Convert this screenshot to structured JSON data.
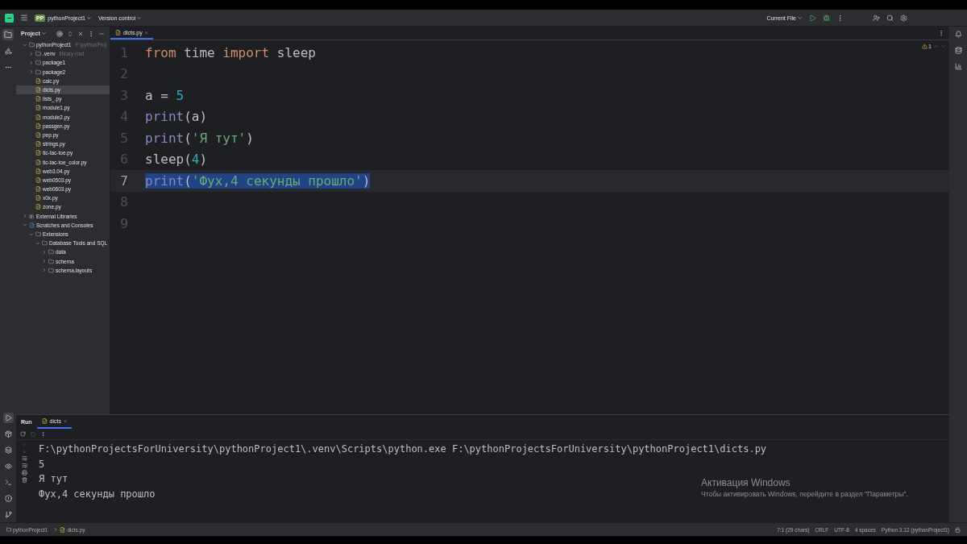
{
  "title_bar": {
    "project_badge": "PP",
    "project": "pythonProject1",
    "vcs": "Version control",
    "run_config": "Current File"
  },
  "project_panel": {
    "title": "Project",
    "tree": [
      {
        "label": "pythonProject1",
        "hint": "F:\\pythonProj",
        "kind": "folder",
        "expanded": true,
        "selected": false,
        "children": [
          {
            "label": ".venv",
            "hint": "library root",
            "kind": "folder",
            "expanded": false,
            "selected": false
          },
          {
            "label": "package1",
            "kind": "folder",
            "expanded": false,
            "selected": false
          },
          {
            "label": "package2",
            "kind": "folder",
            "expanded": false,
            "selected": false
          },
          {
            "label": "calc.py",
            "kind": "python",
            "selected": false
          },
          {
            "label": "dicts.py",
            "kind": "python",
            "selected": true
          },
          {
            "label": "lists_.py",
            "kind": "python",
            "selected": false
          },
          {
            "label": "module1.py",
            "kind": "python",
            "selected": false
          },
          {
            "label": "module2.py",
            "kind": "python",
            "selected": false
          },
          {
            "label": "passgen.py",
            "kind": "python",
            "selected": false
          },
          {
            "label": "pep.py",
            "kind": "python",
            "selected": false
          },
          {
            "label": "strings.py",
            "kind": "python",
            "selected": false
          },
          {
            "label": "tic-tac-toe.py",
            "kind": "python",
            "selected": false
          },
          {
            "label": "tic-tac-toe_color.py",
            "kind": "python",
            "selected": false
          },
          {
            "label": "web3.04.py",
            "kind": "python",
            "selected": false
          },
          {
            "label": "web0503.py",
            "kind": "python",
            "selected": false
          },
          {
            "label": "web0603.py",
            "kind": "python",
            "selected": false
          },
          {
            "label": "x0x.py",
            "kind": "python",
            "selected": false
          },
          {
            "label": "zone.py",
            "kind": "python",
            "selected": false
          }
        ]
      },
      {
        "label": "External Libraries",
        "kind": "library",
        "expanded": false,
        "selected": false
      },
      {
        "label": "Scratches and Consoles",
        "kind": "scratches",
        "expanded": true,
        "selected": false,
        "children": [
          {
            "label": "Extensions",
            "kind": "folder",
            "expanded": true,
            "selected": false,
            "children": [
              {
                "label": "Database Tools and SQL",
                "kind": "folder",
                "expanded": true,
                "selected": false,
                "children": [
                  {
                    "label": "data",
                    "kind": "folder",
                    "expanded": false,
                    "selected": false
                  },
                  {
                    "label": "schema",
                    "kind": "folder",
                    "expanded": false,
                    "selected": false
                  },
                  {
                    "label": "schema.layouts",
                    "kind": "folder",
                    "expanded": false,
                    "selected": false
                  }
                ]
              }
            ]
          }
        ]
      }
    ]
  },
  "editor": {
    "tabs": [
      {
        "label": "dicts.py",
        "close": "×",
        "selected": true
      }
    ],
    "warnings": "1",
    "lines": [
      {
        "number": "1",
        "selected": false,
        "tokens": [
          {
            "text": "from",
            "kind": "keyword"
          },
          {
            "text": " time ",
            "kind": "plain"
          },
          {
            "text": "import",
            "kind": "keyword"
          },
          {
            "text": " sleep",
            "kind": "plain"
          }
        ]
      },
      {
        "number": "2",
        "selected": false
      },
      {
        "number": "3",
        "selected": false,
        "tokens": [
          {
            "text": "a = ",
            "kind": "plain"
          },
          {
            "text": "5",
            "kind": "number"
          }
        ]
      },
      {
        "number": "4",
        "selected": false,
        "tokens": [
          {
            "text": "print",
            "kind": "builtin"
          },
          {
            "text": "(a)",
            "kind": "plain"
          }
        ]
      },
      {
        "number": "5",
        "selected": false,
        "tokens": [
          {
            "text": "print",
            "kind": "builtin"
          },
          {
            "text": "(",
            "kind": "plain"
          },
          {
            "text": "'Я тут'",
            "kind": "string"
          },
          {
            "text": ")",
            "kind": "plain"
          }
        ]
      },
      {
        "number": "6",
        "selected": false,
        "tokens": [
          {
            "text": "sleep(",
            "kind": "plain"
          },
          {
            "text": "4",
            "kind": "number"
          },
          {
            "text": ")",
            "kind": "plain"
          }
        ]
      },
      {
        "number": "7",
        "selected": true,
        "tokens": [
          {
            "text": "print",
            "kind": "builtin"
          },
          {
            "text": "(",
            "kind": "plain"
          },
          {
            "text": "'Фух,4 секунды прошло'",
            "kind": "string"
          },
          {
            "text": ")",
            "kind": "plain"
          }
        ]
      },
      {
        "number": "8",
        "selected": false
      },
      {
        "number": "9",
        "selected": false
      }
    ]
  },
  "run_panel": {
    "title": "Run",
    "tabs": [
      {
        "label": "dicts",
        "close": "×",
        "selected": true
      }
    ],
    "output": [
      "F:\\pythonProjectsForUniversity\\pythonProject1\\.venv\\Scripts\\python.exe F:\\pythonProjectsForUniversity\\pythonProject1\\dicts.py",
      "5",
      "Я тут",
      "Фух,4 секунды прошло"
    ]
  },
  "activation": {
    "title": "Активация Windows",
    "text": "Чтобы активировать Windows, перейдите в раздел \"Параметры\"."
  },
  "status_bar": {
    "breadcrumbs": [
      "pythonProject1",
      "dicts.py"
    ],
    "items": [
      "7:1 (29 chars)",
      "CRLF",
      "UTF-8",
      "4 spaces",
      "Python 3.12 (pythonProject1)"
    ]
  }
}
